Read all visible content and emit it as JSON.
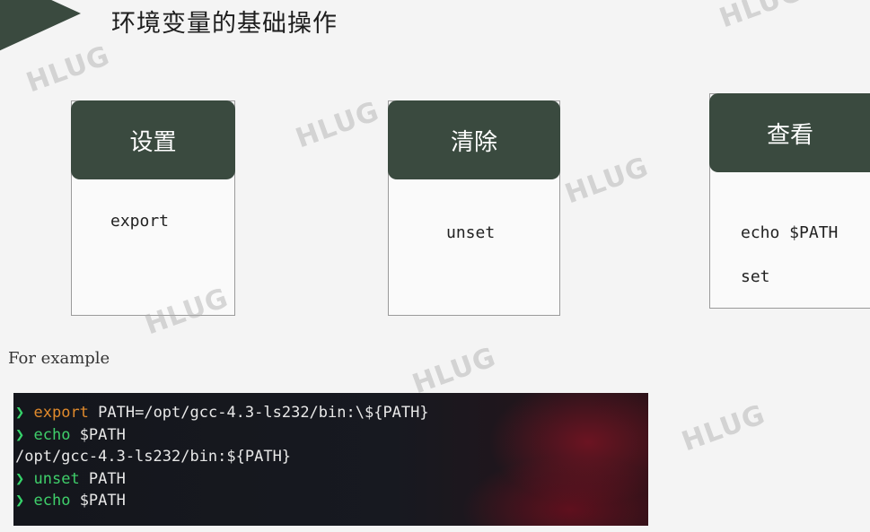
{
  "slide": {
    "title": "环境变量的基础操作",
    "cards": [
      {
        "header": "设置",
        "commands": [
          "export"
        ]
      },
      {
        "header": "清除",
        "commands": [
          "unset"
        ]
      },
      {
        "header": "查看",
        "commands": [
          "echo $PATH",
          "set"
        ]
      }
    ],
    "example_label": "For example"
  },
  "terminal": {
    "prompt_symbol": "❯",
    "lines": [
      {
        "cmd": "export",
        "rest": " PATH=/opt/gcc-4.3-ls232/bin:\\${PATH}"
      },
      {
        "cmd": "echo",
        "rest": " $PATH"
      },
      {
        "output": "/opt/gcc-4.3-ls232/bin:${PATH}"
      },
      {
        "cmd": "unset",
        "rest": " PATH"
      },
      {
        "cmd": "echo",
        "rest": " $PATH"
      }
    ]
  },
  "watermark": {
    "text": "HLUG"
  },
  "colors": {
    "accent": "#3a4a3f",
    "background": "#f4f4f4",
    "terminal_bg": "#14161c",
    "prompt": "#36d36a",
    "export_kw": "#e08a2c",
    "cmd_kw": "#3fcf6a"
  }
}
